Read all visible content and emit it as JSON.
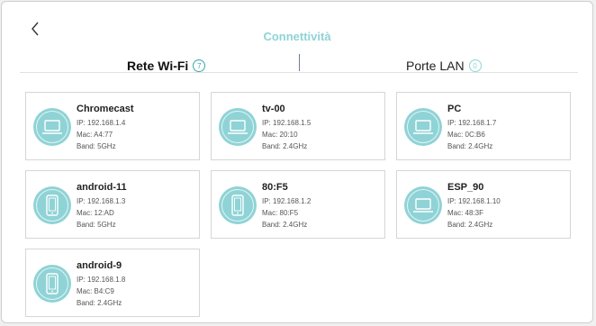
{
  "header": {
    "title": "Connettività"
  },
  "tabs": [
    {
      "label": "Rete Wi-Fi",
      "count": "7",
      "active": true
    },
    {
      "label": "Porte LAN",
      "count": "0",
      "active": false
    }
  ],
  "colors": {
    "accent": "#8fd3d6",
    "accent_dark": "#3aa6ac",
    "divider": "#6a7e96"
  },
  "devices": [
    {
      "name": "Chromecast",
      "ip": "IP: 192.168.1.4",
      "mac": "Mac: A4:77",
      "band": "Band: 5GHz",
      "icon": "laptop-icon"
    },
    {
      "name": "tv-00",
      "ip": "IP: 192.168.1.5",
      "mac": "Mac: 20:10",
      "band": "Band: 2.4GHz",
      "icon": "laptop-icon"
    },
    {
      "name": "PC",
      "ip": "IP: 192.168.1.7",
      "mac": "Mac: 0C:B6",
      "band": "Band: 2.4GHz",
      "icon": "laptop-icon"
    },
    {
      "name": "android-11",
      "ip": "IP: 192.168.1.3",
      "mac": "Mac: 12:AD",
      "band": "Band: 5GHz",
      "icon": "phone-icon"
    },
    {
      "name": "80:F5",
      "ip": "IP: 192.168.1.2",
      "mac": "Mac: 80:F5",
      "band": "Band: 2.4GHz",
      "icon": "phone-icon"
    },
    {
      "name": "ESP_90",
      "ip": "IP: 192.168.1.10",
      "mac": "Mac: 48:3F",
      "band": "Band: 2.4GHz",
      "icon": "laptop-icon"
    },
    {
      "name": "android-9",
      "ip": "IP: 192.168.1.8",
      "mac": "Mac: B4:C9",
      "band": "Band: 2.4GHz",
      "icon": "phone-icon"
    }
  ]
}
